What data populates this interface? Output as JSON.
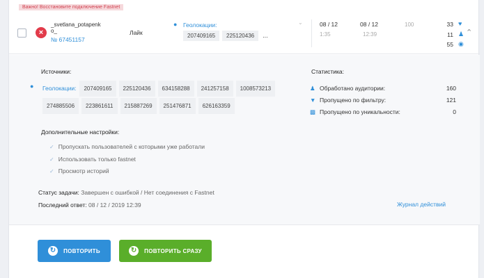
{
  "alert": "Важно! Восстановите подключение Fastnet",
  "task": {
    "username": "_svetlana_potapenko_",
    "id_prefix": "№",
    "id": "67451157",
    "type": "Лайк",
    "geo_label": "Геолокации:",
    "geo_chips": [
      "207409165",
      "225120436"
    ],
    "more": "...",
    "start_date": "08 / 12",
    "start_time": "1:35",
    "end_date": "08 / 12",
    "end_time": "12:39",
    "progress": "100",
    "stat_likes": "33",
    "stat_users": "11",
    "stat_views": "55"
  },
  "details": {
    "sources_title": "Источники:",
    "geo_label": "Геолокации:",
    "geo_chips": [
      "207409165",
      "225120436",
      "634158288",
      "241257158",
      "1008573213",
      "274885506",
      "223861611",
      "215887269",
      "251476871",
      "626163359"
    ],
    "extra_title": "Дополнительные настройки:",
    "options": [
      "Пропускать пользователей с которыми уже работали",
      "Использовать только fastnet",
      "Просмотр историй"
    ],
    "status_label": "Статус задачи:",
    "status_value": "Завершен с ошибкой / Нет соединения с Fastnet",
    "last_label": "Последний ответ:",
    "last_value": "08 / 12 / 2019 12:39",
    "journal_link": "Журнал действий",
    "stats_title": "Статистика:",
    "stats": [
      {
        "label": "Обработано аудитории:",
        "value": "160",
        "icon": "users-icon"
      },
      {
        "label": "Пропущено по фильтру:",
        "value": "121",
        "icon": "filter-icon"
      },
      {
        "label": "Пропущено по уникальности:",
        "value": "0",
        "icon": "unique-icon"
      }
    ]
  },
  "buttons": {
    "retry": "ПОВТОРИТЬ",
    "retry_now": "ПОВТОРИТЬ СРАЗУ"
  },
  "colors": {
    "accent": "#2f8fd9",
    "success": "#5aae2a",
    "error": "#e23b4a"
  }
}
